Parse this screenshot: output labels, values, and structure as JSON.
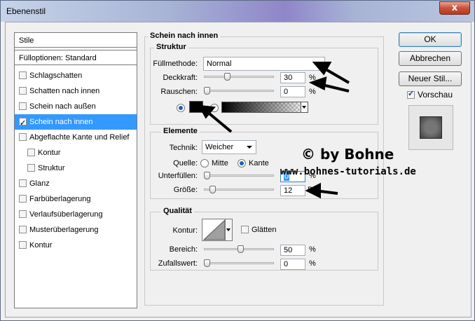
{
  "window": {
    "title": "Ebenenstil",
    "close_label": "x"
  },
  "sidebar": {
    "header": "Stile",
    "blend_options": "Fülloptionen: Standard",
    "items": [
      {
        "label": "Schlagschatten",
        "checked": false
      },
      {
        "label": "Schatten nach innen",
        "checked": false
      },
      {
        "label": "Schein nach außen",
        "checked": false
      },
      {
        "label": "Schein nach innen",
        "checked": true,
        "selected": true
      },
      {
        "label": "Abgeflachte Kante und Relief",
        "checked": false
      },
      {
        "label": "Kontur",
        "checked": false,
        "indent": true
      },
      {
        "label": "Struktur",
        "checked": false,
        "indent": true
      },
      {
        "label": "Glanz",
        "checked": false
      },
      {
        "label": "Farbüberlagerung",
        "checked": false
      },
      {
        "label": "Verlaufsüberlagerung",
        "checked": false
      },
      {
        "label": "Musterüberlagerung",
        "checked": false
      },
      {
        "label": "Kontur",
        "checked": false
      }
    ]
  },
  "panel": {
    "title": "Schein nach innen",
    "struktur": {
      "title": "Struktur",
      "blend_label": "Füllmethode:",
      "blend_value": "Normal",
      "opacity_label": "Deckkraft:",
      "opacity_value": "30",
      "opacity_level": 0.3,
      "noise_label": "Rauschen:",
      "noise_value": "0",
      "noise_level": 0,
      "unit": "%",
      "color": "#000000"
    },
    "elemente": {
      "title": "Elemente",
      "technique_label": "Technik:",
      "technique_value": "Weicher",
      "source_label": "Quelle:",
      "source_center": "Mitte",
      "source_edge": "Kante",
      "choke_label": "Unterfüllen:",
      "choke_value": "0",
      "choke_level": 0,
      "size_label": "Größe:",
      "size_value": "12",
      "size_unit": "Px",
      "unit": "%"
    },
    "qualitaet": {
      "title": "Qualität",
      "contour_label": "Kontur:",
      "antialias_label": "Glätten",
      "range_label": "Bereich:",
      "range_value": "50",
      "range_level": 0.5,
      "jitter_label": "Zufallswert:",
      "jitter_value": "0",
      "jitter_level": 0,
      "unit": "%"
    }
  },
  "buttons": {
    "ok": "OK",
    "cancel": "Abbrechen",
    "new_style": "Neuer Stil...",
    "preview_label": "Vorschau"
  },
  "watermark": {
    "line1": "© by Bohne",
    "line2": "www.bohnes-tutorials.de"
  }
}
